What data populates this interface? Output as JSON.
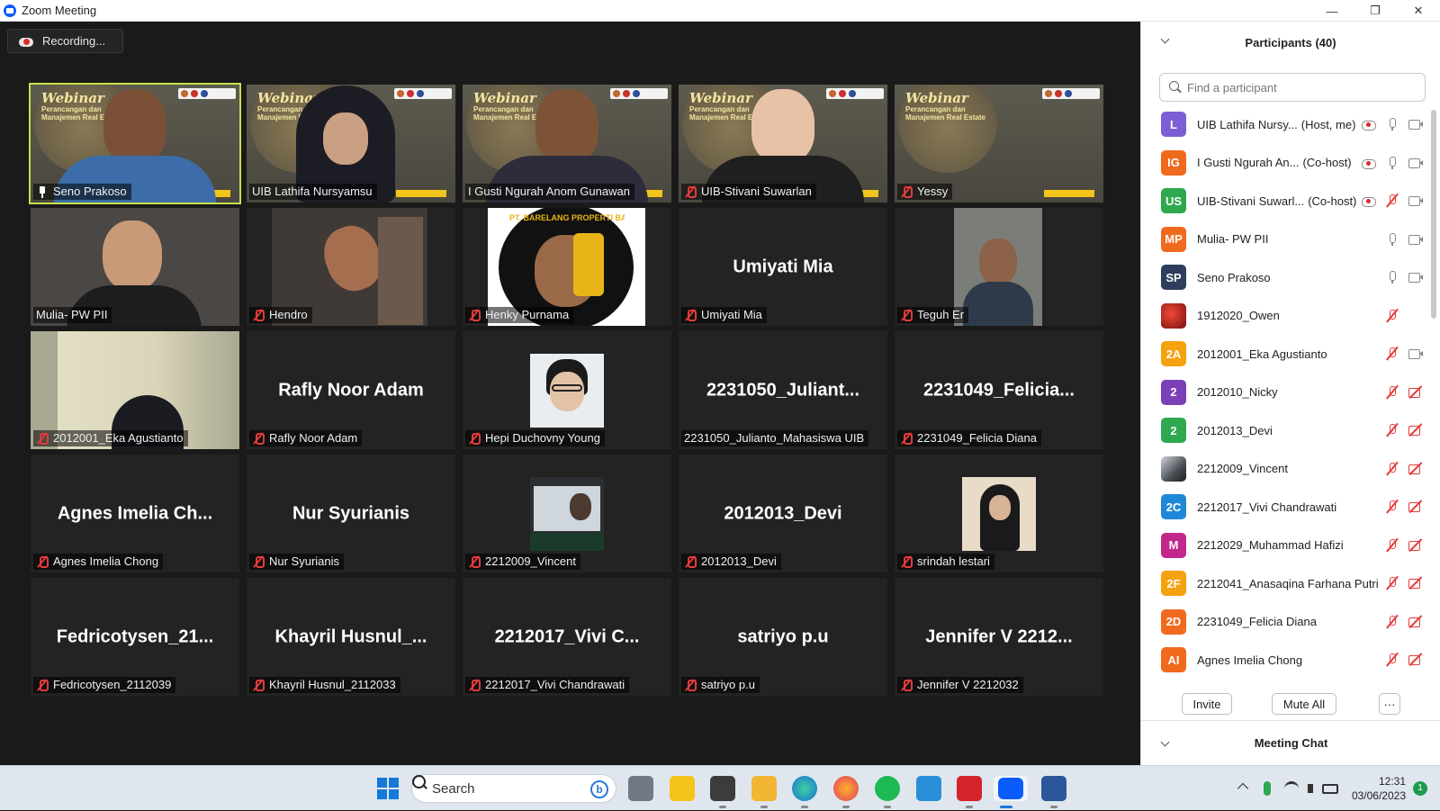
{
  "window": {
    "title": "Zoom Meeting",
    "minimize": "—",
    "restore": "❐",
    "close": "✕"
  },
  "recording": {
    "label": "Recording..."
  },
  "tiles": [
    {
      "label": "Seno Prakoso",
      "big": "",
      "muted": false,
      "pinned": true,
      "kind": "banner-person",
      "skin": "#7a5036",
      "shirt": "#3c6da8",
      "active": true
    },
    {
      "label": "UIB Lathifa Nursyamsu",
      "big": "",
      "muted": false,
      "pinned": false,
      "kind": "banner-hijab"
    },
    {
      "label": "I Gusti Ngurah Anom Gunawan",
      "big": "",
      "muted": false,
      "pinned": false,
      "kind": "banner-person",
      "skin": "#7d5338",
      "shirt": "#2c2c3a"
    },
    {
      "label": "UIB-Stivani Suwarlan",
      "big": "",
      "muted": true,
      "pinned": false,
      "kind": "banner-person",
      "skin": "#e7c2a6",
      "shirt": "#1f1f1f"
    },
    {
      "label": "Yessy",
      "big": "",
      "muted": true,
      "pinned": false,
      "kind": "banner"
    },
    {
      "label": "Mulia- PW PII",
      "big": "",
      "muted": false,
      "pinned": false,
      "kind": "video-person",
      "skin": "#c99a78",
      "shirt": "#1d1d1d",
      "bg": "#4b4744"
    },
    {
      "label": "Hendro",
      "big": "",
      "muted": true,
      "pinned": false,
      "kind": "video-car",
      "skin": "#a56f4f",
      "shirt": "#5d5a55",
      "bg": "#3f3a36"
    },
    {
      "label": "Henky Purnama",
      "big": "",
      "muted": true,
      "pinned": false,
      "kind": "logo-person"
    },
    {
      "label": "Umiyati Mia",
      "big": "Umiyati Mia",
      "muted": true,
      "pinned": false,
      "kind": "name"
    },
    {
      "label": "Teguh Er",
      "big": "",
      "muted": true,
      "pinned": false,
      "kind": "video-person-narrow",
      "skin": "#8c6248",
      "shirt": "#2f3b4a",
      "bg": "#7a7d78"
    },
    {
      "label": "2012001_Eka Agustianto",
      "big": "",
      "muted": true,
      "pinned": false,
      "kind": "video-room"
    },
    {
      "label": "Rafly Noor Adam",
      "big": "Rafly Noor Adam",
      "muted": true,
      "pinned": false,
      "kind": "name"
    },
    {
      "label": "Hepi Duchovny Young",
      "big": "",
      "muted": true,
      "pinned": false,
      "kind": "thumb-face"
    },
    {
      "label": "2231050_Julianto_Mahasiswa UIB",
      "big": "2231050_Juliant...",
      "muted": false,
      "pinned": false,
      "kind": "name"
    },
    {
      "label": "2231049_Felicia Diana",
      "big": "2231049_Felicia...",
      "muted": true,
      "pinned": false,
      "kind": "name"
    },
    {
      "label": "Agnes Imelia Chong",
      "big": "Agnes Imelia Ch...",
      "muted": true,
      "pinned": false,
      "kind": "name"
    },
    {
      "label": "Nur Syurianis",
      "big": "Nur Syurianis",
      "muted": true,
      "pinned": false,
      "kind": "name"
    },
    {
      "label": "2212009_Vincent",
      "big": "",
      "muted": true,
      "pinned": false,
      "kind": "thumb-laptop"
    },
    {
      "label": "2012013_Devi",
      "big": "2012013_Devi",
      "muted": true,
      "pinned": false,
      "kind": "name"
    },
    {
      "label": "srindah lestari",
      "big": "",
      "muted": true,
      "pinned": false,
      "kind": "thumb-hijab"
    },
    {
      "label": "Fedricotysen_2112039",
      "big": "Fedricotysen_21...",
      "muted": true,
      "pinned": false,
      "kind": "name"
    },
    {
      "label": "Khayril Husnul_2112033",
      "big": "Khayril Husnul_...",
      "muted": true,
      "pinned": false,
      "kind": "name"
    },
    {
      "label": "2212017_Vivi Chandrawati",
      "big": "2212017_Vivi C...",
      "muted": true,
      "pinned": false,
      "kind": "name"
    },
    {
      "label": "satriyo p.u",
      "big": "satriyo p.u",
      "muted": true,
      "pinned": false,
      "kind": "name"
    },
    {
      "label": "Jennifer V 2212032",
      "big": "Jennifer V 2212...",
      "muted": true,
      "pinned": false,
      "kind": "name"
    }
  ],
  "banner": {
    "title": "Webinar",
    "subtitle": "Perancangan dan Manajemen Real Estate"
  },
  "henky_logo": {
    "text": "PT. BARELANG PROPERTI BATAM"
  },
  "participants_panel": {
    "title": "Participants (40)",
    "search_placeholder": "Find a participant",
    "participants": [
      {
        "initials": "L",
        "color": "#7b5fd6",
        "name": "UIB Lathifa Nursy...",
        "role": "(Host, me)",
        "rec": true,
        "mic": "on",
        "cam": "on"
      },
      {
        "initials": "IG",
        "color": "#f06a1e",
        "name": "I Gusti Ngurah An...",
        "role": "(Co-host)",
        "rec": true,
        "mic": "on",
        "cam": "on"
      },
      {
        "initials": "US",
        "color": "#2fa84f",
        "name": "UIB-Stivani Suwarl...",
        "role": "(Co-host)",
        "rec": true,
        "mic": "off",
        "cam": "on"
      },
      {
        "initials": "MP",
        "color": "#f06a1e",
        "name": "Mulia- PW PII",
        "role": "",
        "rec": false,
        "mic": "on",
        "cam": "on"
      },
      {
        "initials": "SP",
        "color": "#2d3e5e",
        "name": "Seno Prakoso",
        "role": "",
        "rec": false,
        "mic": "on",
        "cam": "on"
      },
      {
        "initials": "",
        "color": "#c0211c",
        "name": "1912020_Owen",
        "role": "",
        "rec": false,
        "mic": "off",
        "cam": "none"
      },
      {
        "initials": "2A",
        "color": "#f4a20f",
        "name": "2012001_Eka Agustianto",
        "role": "",
        "rec": false,
        "mic": "off",
        "cam": "on"
      },
      {
        "initials": "2",
        "color": "#7b3fb8",
        "name": "2012010_Nicky",
        "role": "",
        "rec": false,
        "mic": "off",
        "cam": "off"
      },
      {
        "initials": "2",
        "color": "#2fa84f",
        "name": "2012013_Devi",
        "role": "",
        "rec": false,
        "mic": "off",
        "cam": "off"
      },
      {
        "initials": "",
        "color": "#5a5f66",
        "name": "2212009_Vincent",
        "role": "",
        "rec": false,
        "mic": "off",
        "cam": "off"
      },
      {
        "initials": "2C",
        "color": "#1e88d8",
        "name": "2212017_Vivi Chandrawati",
        "role": "",
        "rec": false,
        "mic": "off",
        "cam": "off"
      },
      {
        "initials": "M",
        "color": "#c2288b",
        "name": "2212029_Muhammad Hafizi",
        "role": "",
        "rec": false,
        "mic": "off",
        "cam": "off"
      },
      {
        "initials": "2F",
        "color": "#f4a20f",
        "name": "2212041_Anasaqina Farhana Putri",
        "role": "",
        "rec": false,
        "mic": "off",
        "cam": "off"
      },
      {
        "initials": "2D",
        "color": "#f06a1e",
        "name": "2231049_Felicia Diana",
        "role": "",
        "rec": false,
        "mic": "off",
        "cam": "off"
      },
      {
        "initials": "AI",
        "color": "#f06a1e",
        "name": "Agnes Imelia Chong",
        "role": "",
        "rec": false,
        "mic": "off",
        "cam": "off"
      }
    ],
    "invite_label": "Invite",
    "mute_all_label": "Mute All",
    "more_label": "···",
    "chat_title": "Meeting Chat"
  },
  "taskbar": {
    "search_label": "Search",
    "bing_label": "b",
    "time": "12:31",
    "date": "03/06/2023",
    "notifications": "1"
  }
}
